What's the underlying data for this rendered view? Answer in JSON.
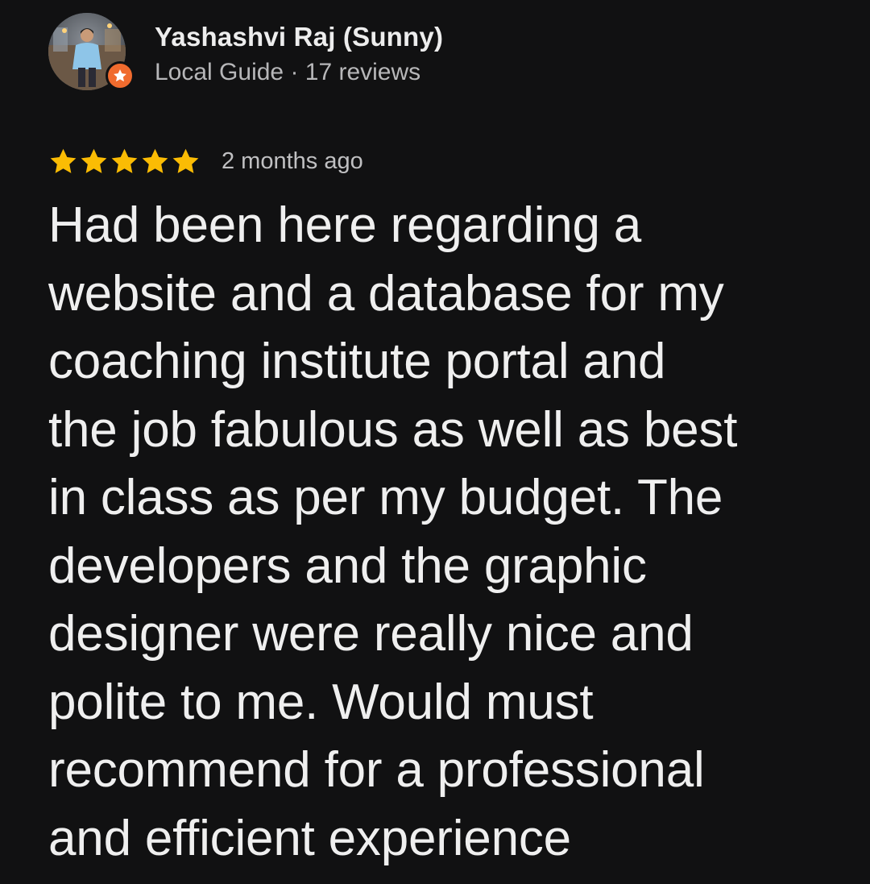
{
  "review": {
    "author": {
      "name": "Yashashvi Raj (Sunny)",
      "meta": "Local Guide · 17 reviews",
      "badge_icon": "local-guide-star-icon",
      "badge_color": "#f06b2e"
    },
    "rating": {
      "stars": 5,
      "max_stars": 5,
      "star_color": "#fbbc04"
    },
    "time": "2 months ago",
    "text_lines": [
      "Had been here regarding a",
      "website and a database for my",
      "coaching institute portal and",
      "the job fabulous as well as best",
      "in class as per my budget. The",
      "developers and the graphic",
      "designer were really nice and",
      "polite to me. Would must",
      "recommend for a professional",
      "and efficient experience"
    ]
  },
  "theme": {
    "background": "#111112",
    "text": "#efefef",
    "secondary_text": "#b7b7b9"
  }
}
